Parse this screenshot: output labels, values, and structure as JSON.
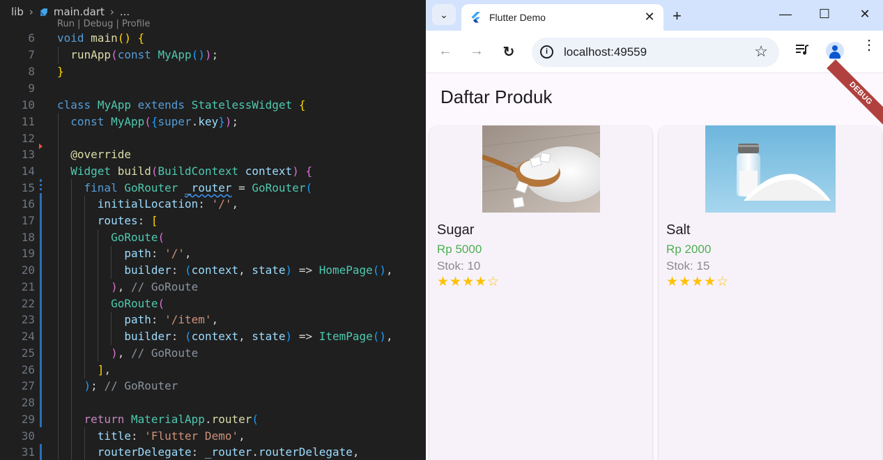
{
  "editor": {
    "breadcrumb": [
      "lib",
      "main.dart",
      "..."
    ],
    "codelens": "Run | Debug | Profile",
    "lines": [
      {
        "n": "6"
      },
      {
        "n": "7"
      },
      {
        "n": "8"
      },
      {
        "n": "9"
      },
      {
        "n": "10"
      },
      {
        "n": "11"
      },
      {
        "n": "12"
      },
      {
        "n": "13"
      },
      {
        "n": "14"
      },
      {
        "n": "15"
      },
      {
        "n": "16"
      },
      {
        "n": "17"
      },
      {
        "n": "18"
      },
      {
        "n": "19"
      },
      {
        "n": "20"
      },
      {
        "n": "21"
      },
      {
        "n": "22"
      },
      {
        "n": "23"
      },
      {
        "n": "24"
      },
      {
        "n": "25"
      },
      {
        "n": "26"
      },
      {
        "n": "27"
      },
      {
        "n": "28"
      },
      {
        "n": "29"
      },
      {
        "n": "30"
      },
      {
        "n": "31"
      }
    ],
    "tokens": {
      "void": "void",
      "main": "main",
      "runApp": "runApp",
      "const": "const",
      "MyApp": "MyApp",
      "class": "class",
      "extends": "extends",
      "StatelessWidget": "StatelessWidget",
      "super": "super",
      "key": "key",
      "override": "@override",
      "Widget": "Widget",
      "build": "build",
      "BuildContext": "BuildContext",
      "context": "context",
      "final": "final",
      "GoRouter": "GoRouter",
      "router": "_router",
      "initialLocation": "initialLocation",
      "slash": "'/'",
      "routes": "routes",
      "GoRoute": "GoRoute",
      "path": "path",
      "builder": "builder",
      "state": "state",
      "HomePage": "HomePage",
      "item": "'/item'",
      "ItemPage": "ItemPage",
      "cmGoRoute": "// GoRoute",
      "cmGoRouter": "// GoRouter",
      "return": "return",
      "MaterialApp": "MaterialApp",
      "routerFn": "router",
      "title": "title",
      "flutterDemo": "'Flutter Demo'",
      "routerDelegate": "routerDelegate"
    }
  },
  "browser": {
    "tab_title": "Flutter Demo",
    "url": "localhost:49559",
    "info_glyph": "i",
    "icons": {
      "back": "←",
      "forward": "→",
      "reload": "↻",
      "star": "☆",
      "close": "✕",
      "newtab": "+",
      "minimize": "—",
      "maximize": "☐",
      "winclose": "✕",
      "tabsearch": "⌄",
      "menu": "⋮"
    }
  },
  "app": {
    "title": "Daftar Produk",
    "debug_banner": "DEBUG",
    "products": [
      {
        "name": "Sugar",
        "price": "Rp 5000",
        "stock": "Stok: 10",
        "rating": 4,
        "stars": "★★★★☆"
      },
      {
        "name": "Salt",
        "price": "Rp 2000",
        "stock": "Stok: 15",
        "rating": 4,
        "stars": "★★★★☆"
      }
    ]
  },
  "colors": {
    "accent": "#0b57d0",
    "price_green": "#4caf50",
    "star": "#ffc107",
    "debug": "#b0413e"
  }
}
